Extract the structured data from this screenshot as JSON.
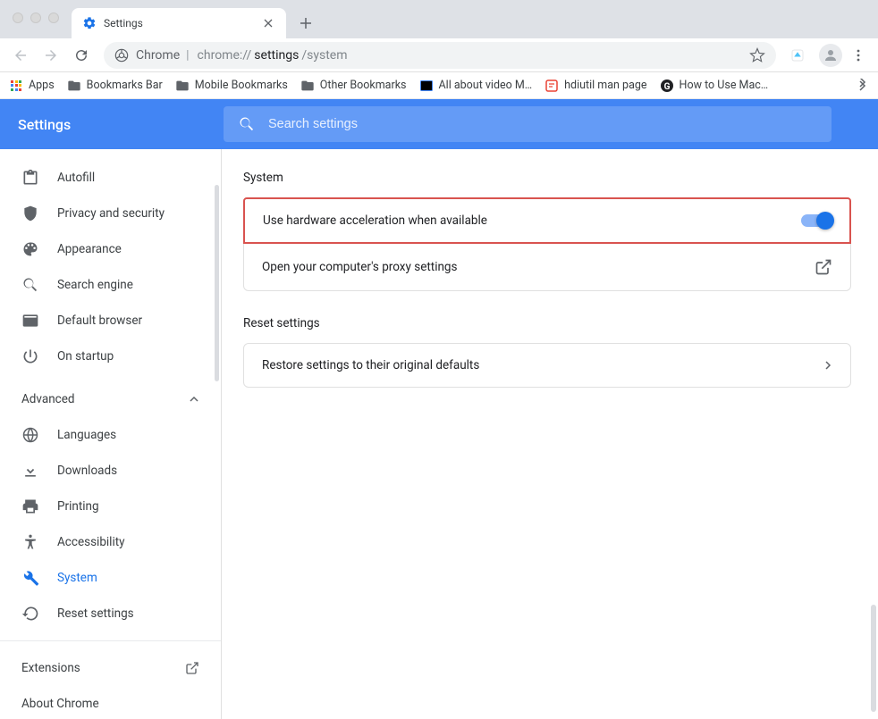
{
  "window": {
    "tab_title": "Settings"
  },
  "toolbar": {
    "omnibox_label": "Chrome",
    "omnibox_url_prefix": "chrome://",
    "omnibox_url_bold": "settings",
    "omnibox_url_suffix": "/system"
  },
  "bookmarks": {
    "apps": "Apps",
    "items": [
      "Bookmarks Bar",
      "Mobile Bookmarks",
      "Other Bookmarks",
      "All about video M…",
      "hdiutil man page",
      "How to Use Mac…"
    ]
  },
  "header": {
    "title": "Settings",
    "search_placeholder": "Search settings"
  },
  "sidebar": {
    "items": [
      {
        "icon": "clipboard",
        "label": "Autofill"
      },
      {
        "icon": "shield",
        "label": "Privacy and security"
      },
      {
        "icon": "palette",
        "label": "Appearance"
      },
      {
        "icon": "search",
        "label": "Search engine"
      },
      {
        "icon": "browser",
        "label": "Default browser"
      },
      {
        "icon": "power",
        "label": "On startup"
      }
    ],
    "advanced_label": "Advanced",
    "advanced_items": [
      {
        "icon": "globe",
        "label": "Languages"
      },
      {
        "icon": "download",
        "label": "Downloads"
      },
      {
        "icon": "printer",
        "label": "Printing"
      },
      {
        "icon": "accessibility",
        "label": "Accessibility"
      },
      {
        "icon": "wrench",
        "label": "System",
        "active": true
      },
      {
        "icon": "restore",
        "label": "Reset settings"
      }
    ],
    "extensions": "Extensions",
    "about": "About Chrome"
  },
  "content": {
    "section1_title": "System",
    "row1": "Use hardware acceleration when available",
    "row2": "Open your computer's proxy settings",
    "section2_title": "Reset settings",
    "row3": "Restore settings to their original defaults"
  }
}
